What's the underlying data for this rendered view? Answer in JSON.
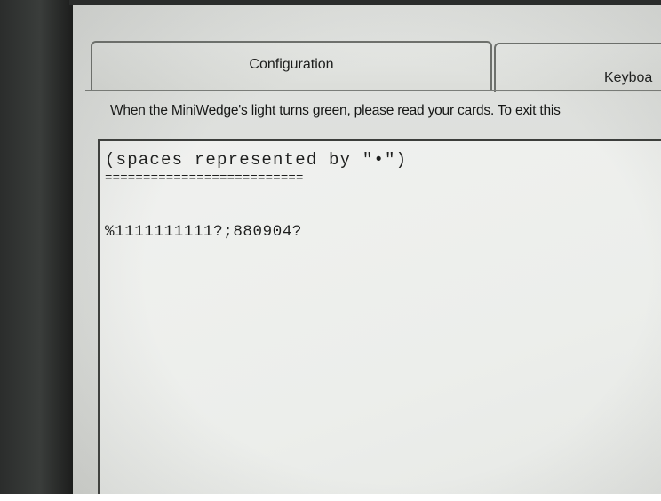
{
  "tabs": [
    {
      "label": "Configuration"
    },
    {
      "label": "Keyboa"
    }
  ],
  "instruction": "When the MiniWedge's light turns green, please read your cards.  To exit this",
  "output": {
    "line1": "(spaces represented by \"•\")",
    "line2": "==========================",
    "line3": "%1111111111?;880904?"
  }
}
